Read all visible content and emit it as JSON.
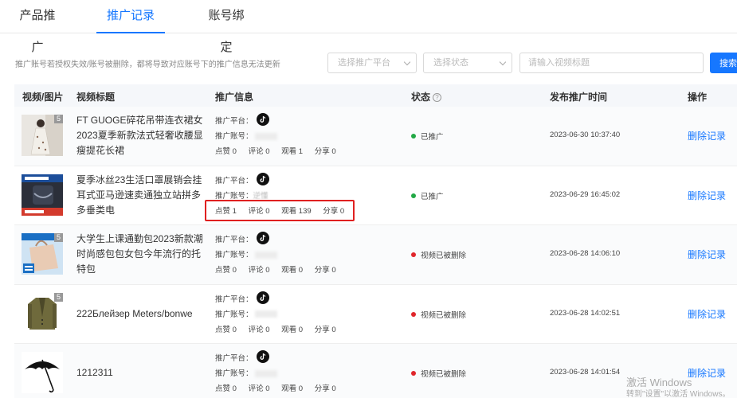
{
  "tabs": [
    {
      "label": "产品推广",
      "active": false
    },
    {
      "label": "推广记录",
      "active": true
    },
    {
      "label": "账号绑定",
      "active": false
    }
  ],
  "toolbar": {
    "notice": "推广账号若授权失效/账号被删除，都将导致对应账号下的推广信息无法更新",
    "platform_placeholder": "选择推广平台",
    "status_placeholder": "选择状态",
    "search_placeholder": "请输入视频标题",
    "search_label": "搜索"
  },
  "columns": {
    "media": "视频/图片",
    "title": "视频标题",
    "info": "推广信息",
    "status": "状态",
    "time": "发布推广时间",
    "action": "操作"
  },
  "labels": {
    "platform": "推广平台：",
    "account": "推广账号：",
    "account_partial_row2": "逆懂",
    "delete": "删除记录"
  },
  "rows": [
    {
      "badge": "5",
      "title": "FT GUOGE碎花吊带连衣裙女2023夏季新款法式轻奢收腰显瘦提花长裙",
      "stats": {
        "likes": "点赞 0",
        "comments": "评论 0",
        "views": "观看 1",
        "shares": "分享 0"
      },
      "status": "已推广",
      "status_color": "#22a845",
      "time": "2023-06-30 10:37:40"
    },
    {
      "badge": "",
      "title": "夏季冰丝23生活口罩展销会挂耳式亚马逊速卖通独立站拼多多垂类电",
      "stats": {
        "likes": "点赞 1",
        "comments": "评论 0",
        "views": "观看 139",
        "shares": "分享 0"
      },
      "status": "已推广",
      "status_color": "#22a845",
      "time": "2023-06-29 16:45:02"
    },
    {
      "badge": "5",
      "title": "大学生上课通勤包2023新款潮时尚感包包女包今年流行的托特包",
      "stats": {
        "likes": "点赞 0",
        "comments": "评论 0",
        "views": "观看 0",
        "shares": "分享 0"
      },
      "status": "视频已被删除",
      "status_color": "#e0262b",
      "time": "2023-06-28 14:06:10"
    },
    {
      "badge": "5",
      "title": "222Блейзер Meters/bonwe",
      "stats": {
        "likes": "点赞 0",
        "comments": "评论 0",
        "views": "观看 0",
        "shares": "分享 0"
      },
      "status": "视频已被删除",
      "status_color": "#e0262b",
      "time": "2023-06-28 14:02:51"
    },
    {
      "badge": "",
      "title": "1212311",
      "stats": {
        "likes": "点赞 0",
        "comments": "评论 0",
        "views": "观看 0",
        "shares": "分享 0"
      },
      "status": "视频已被删除",
      "status_color": "#e0262b",
      "time": "2023-06-28 14:01:54"
    }
  ],
  "watermark": {
    "line1": "激活 Windows",
    "line2": "转到\"设置\"以激活 Windows。"
  },
  "colors": {
    "accent": "#1677ff",
    "ok": "#22a845",
    "deleted": "#e0262b",
    "highlight": "#e02020"
  }
}
